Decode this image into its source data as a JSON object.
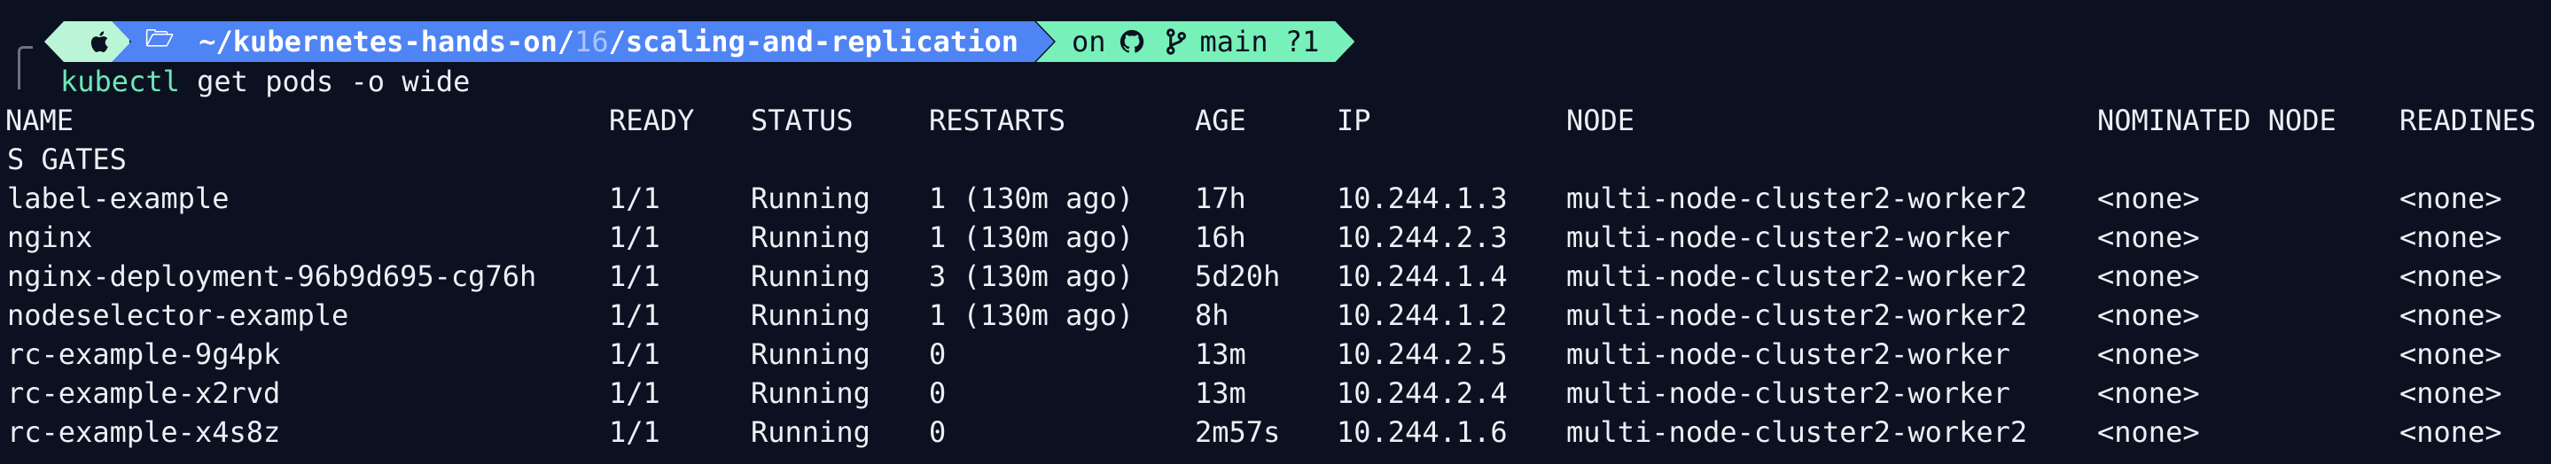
{
  "prompt": {
    "os_icon": "apple-icon",
    "path_icon": "folder-icon",
    "path_prefix": "~/kubernetes-hands-on/",
    "path_dim": "16",
    "path_suffix": "/scaling-and-replication",
    "git_on": "on",
    "git_icon": "github-icon",
    "branch_icon": "git-branch-icon",
    "branch": "main ?1",
    "colors": {
      "os_segment": "#b9f5d6",
      "path_segment": "#4f84f4",
      "git_segment": "#78f0b9"
    }
  },
  "command": {
    "name": "kubectl",
    "args": " get pods -o wide"
  },
  "table": {
    "headers": [
      "NAME",
      "READY",
      "STATUS",
      "RESTARTS",
      "AGE",
      "IP",
      "NODE",
      "NOMINATED NODE",
      "READINES"
    ],
    "header_wrap": "S GATES",
    "rows": [
      [
        "label-example",
        "1/1",
        "Running",
        "1 (130m ago)",
        "17h",
        "10.244.1.3",
        "multi-node-cluster2-worker2",
        "<none>",
        "<none>"
      ],
      [
        "nginx",
        "1/1",
        "Running",
        "1 (130m ago)",
        "16h",
        "10.244.2.3",
        "multi-node-cluster2-worker",
        "<none>",
        "<none>"
      ],
      [
        "nginx-deployment-96b9d695-cg76h",
        "1/1",
        "Running",
        "3 (130m ago)",
        "5d20h",
        "10.244.1.4",
        "multi-node-cluster2-worker2",
        "<none>",
        "<none>"
      ],
      [
        "nodeselector-example",
        "1/1",
        "Running",
        "1 (130m ago)",
        "8h",
        "10.244.1.2",
        "multi-node-cluster2-worker2",
        "<none>",
        "<none>"
      ],
      [
        "rc-example-9g4pk",
        "1/1",
        "Running",
        "0",
        "13m",
        "10.244.2.5",
        "multi-node-cluster2-worker",
        "<none>",
        "<none>"
      ],
      [
        "rc-example-x2rvd",
        "1/1",
        "Running",
        "0",
        "13m",
        "10.244.2.4",
        "multi-node-cluster2-worker",
        "<none>",
        "<none>"
      ],
      [
        "rc-example-x4s8z",
        "1/1",
        "Running",
        "0",
        "2m57s",
        "10.244.1.6",
        "multi-node-cluster2-worker2",
        "<none>",
        "<none>"
      ]
    ]
  }
}
